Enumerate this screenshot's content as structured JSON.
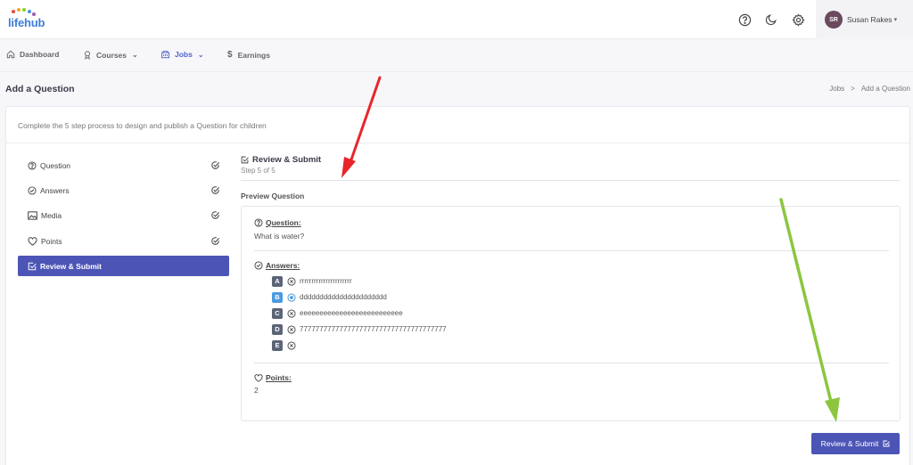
{
  "app": {
    "logo": "lifehub"
  },
  "user": {
    "initials": "SR",
    "name": "Susan Rakes"
  },
  "nav": {
    "dashboard": "Dashboard",
    "courses": "Courses",
    "jobs": "Jobs",
    "earnings": "Earnings"
  },
  "page": {
    "title": "Add a Question",
    "breadcrumb": [
      "Jobs",
      "Add a Question"
    ],
    "breadcrumb_sep": ">"
  },
  "card": {
    "intro": "Complete the 5 step process to design and publish a Question for children"
  },
  "steps": [
    {
      "label": "Question",
      "icon": "help-circle-icon",
      "done": true
    },
    {
      "label": "Answers",
      "icon": "check-circle-icon",
      "done": true
    },
    {
      "label": "Media",
      "icon": "image-icon",
      "done": true
    },
    {
      "label": "Points",
      "icon": "heart-icon",
      "done": true
    },
    {
      "label": "Review & Submit",
      "icon": "check-square-icon",
      "active": true
    }
  ],
  "review": {
    "title": "Review & Submit",
    "step_text": "Step 5 of 5",
    "preview_label": "Preview Question",
    "question_label": "Question:",
    "question_value": "What is water?",
    "answers_label": "Answers:",
    "answers": [
      {
        "letter": "A",
        "text": "rrrrrrrrrrrrrrrrrrrrrr",
        "correct": false
      },
      {
        "letter": "B",
        "text": "dddddddddddddddddddddd",
        "correct": true
      },
      {
        "letter": "C",
        "text": "eeeeeeeeeeeeeeeeeeeeeeeeee",
        "correct": false
      },
      {
        "letter": "D",
        "text": "7777777777777777777777777777777777777",
        "correct": false
      },
      {
        "letter": "E",
        "text": "",
        "correct": false
      }
    ],
    "points_label": "Points:",
    "points_value": "2"
  },
  "submit_button": "Review & Submit",
  "colors": {
    "primary": "#4c55b6",
    "correct": "#4a9be0",
    "letter_badge": "#5b6477",
    "annotation_red": "#e8262a",
    "annotation_green": "#8cc63f"
  }
}
